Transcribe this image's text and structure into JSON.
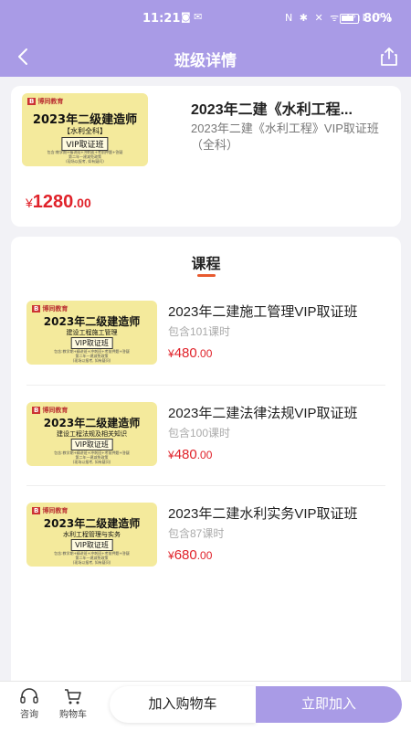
{
  "status_bar": {
    "time": "11:21",
    "left_icons": "◙ ✉",
    "right_icons": "N ✱ ✕ ᯤ ⁴⁶ıl ⁴⁶ıl",
    "battery": "80%"
  },
  "nav": {
    "title": "班级详情",
    "back_icon": "chevron-left-icon",
    "share_icon": "share-icon"
  },
  "class_info": {
    "cover": {
      "brand": "博同教育",
      "brand_mark": "B",
      "title": "2023年二级建造师",
      "subtitle": "【水利全科】",
      "badge": "VIP取证班",
      "fine_print_1": "包含:教学期+精讲班+冲刺班+考前押题+答疑",
      "fine_print_2": "第二年一建减免政策",
      "fine_print_3": "(现场以报考, 如有疑问)"
    },
    "name": "2023年二建《水利工程...",
    "description": "2023年二建《水利工程》VIP取证班（全科）",
    "price_currency": "¥",
    "price_int": "1280",
    "price_dec": ".00"
  },
  "section": {
    "title": "课程"
  },
  "courses": [
    {
      "cover_title": "2023年二级建造师",
      "cover_sub": "建设工程施工管理",
      "cover_badge": "VIP取证班",
      "name": "2023年二建施工管理VIP取证班",
      "lessons": "包含101课时",
      "currency": "¥",
      "price_int": "480",
      "price_dec": ".00"
    },
    {
      "cover_title": "2023年二级建造师",
      "cover_sub": "建设工程法规及相关知识",
      "cover_badge": "VIP取证班",
      "name": "2023年二建法律法规VIP取证班",
      "lessons": "包含100课时",
      "currency": "¥",
      "price_int": "480",
      "price_dec": ".00"
    },
    {
      "cover_title": "2023年二级建造师",
      "cover_sub": "水利工程管理与实务",
      "cover_badge": "VIP取证班",
      "name": "2023年二建水利实务VIP取证班",
      "lessons": "包含87课时",
      "currency": "¥",
      "price_int": "680",
      "price_dec": ".00"
    }
  ],
  "bottom": {
    "consult_label": "咨询",
    "cart_label": "购物车",
    "add_cart_label": "加入购物车",
    "join_label": "立即加入"
  },
  "colors": {
    "brand_purple": "#a99be6",
    "price_red": "#e0222a",
    "accent_orange": "#e85a2f",
    "cover_yellow": "#f4ea9c"
  }
}
